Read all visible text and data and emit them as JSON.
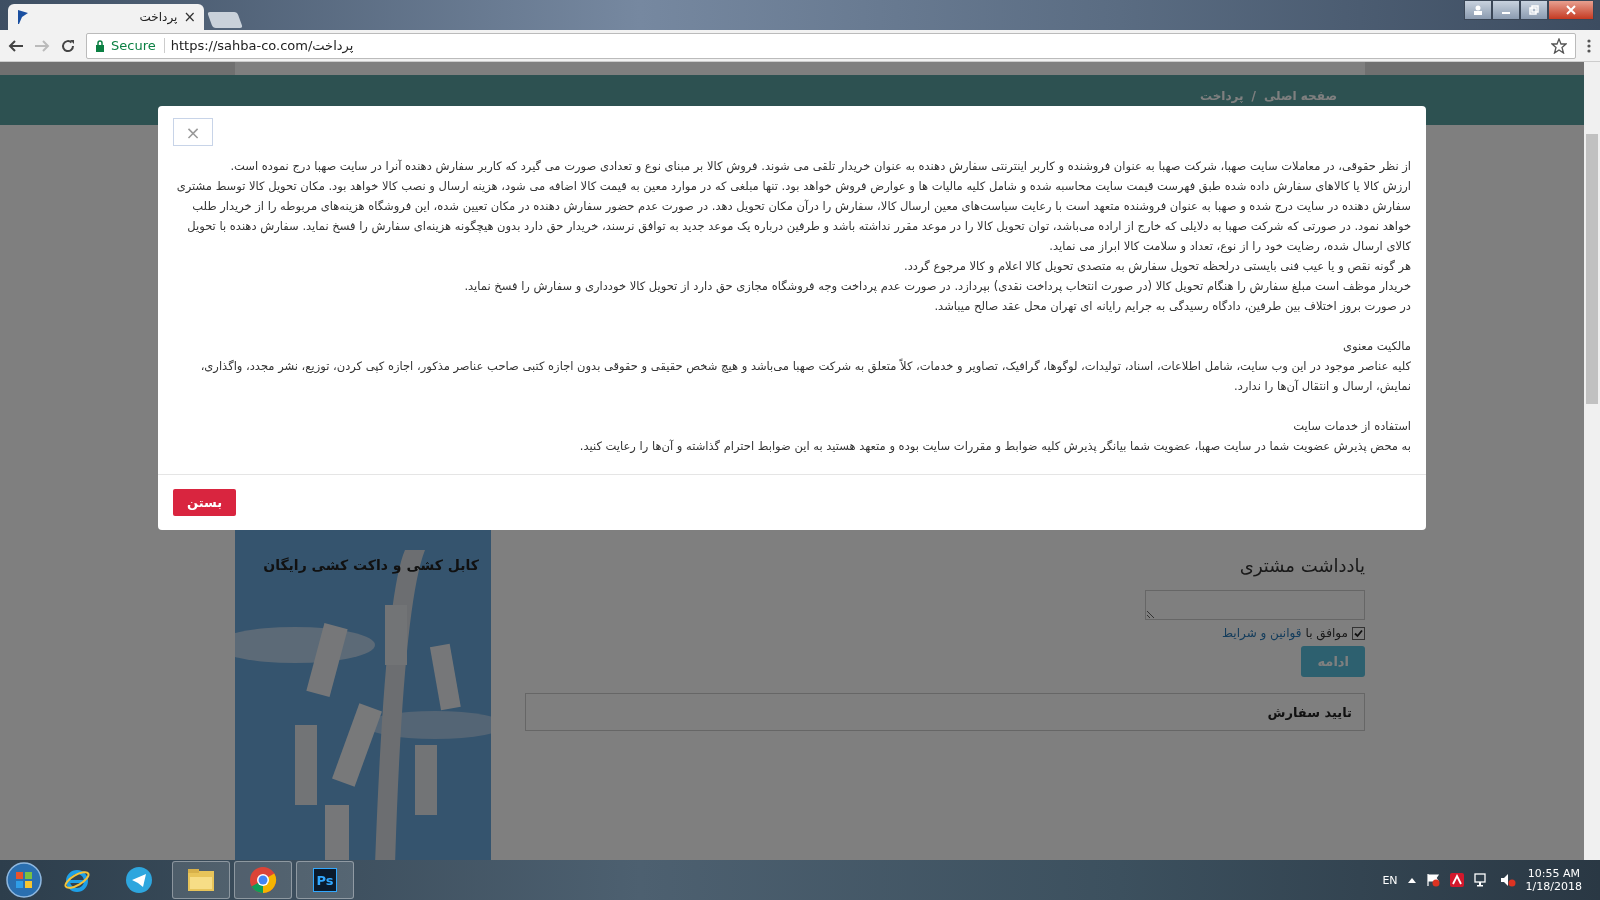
{
  "browser": {
    "tab": {
      "title": "پرداخت",
      "close": "×"
    },
    "address": {
      "secure": "Secure",
      "url": "https://sahba-co.com/پرداخت"
    }
  },
  "page": {
    "breadcrumb": [
      {
        "label": "صفحه اصلی"
      },
      {
        "label": "پرداخت"
      }
    ],
    "breadcrumb_separator": "/",
    "promo": {
      "title": "کابل کشی و داکت کشی رایگان",
      "kind": "picture"
    },
    "customer_note": {
      "heading": "یادداشت مشتری"
    },
    "terms": {
      "checked": true,
      "prefix": "موافق با",
      "link": "قوانین و شرایط"
    },
    "continue_button": "ادامه",
    "order_panel": {
      "title": "تایید سفارش"
    }
  },
  "modal": {
    "close": "×",
    "blocks": [
      {
        "kind": "paragraph",
        "text": "از نظر حقوقی، در معاملات سایت صهبا، شرکت صهبا به عنوان فروشنده و کاربر اینترنتی سفارش دهنده به عنوان خریدار تلقی می شوند. فروش کالا بر مبنای نوع و تعدادی صورت می گیرد که کاربر سفارش دهنده آنرا در سایت صهبا درج نموده است."
      },
      {
        "kind": "paragraph",
        "text": "ارزش کالا یا کالاهای سفارش داده شده طبق فهرست قیمت سایت محاسبه شده و شامل کلیه مالیات ها و عوارض فروش خواهد بود. تنها مبلغی که در موارد معین به قیمت کالا اضافه می شود، هزینه ارسال و نصب کالا خواهد بود. مکان تحویل کالا توسط مشتری سفارش دهنده در سایت درج شده و صهبا به عنوان فروشنده متعهد است با رعایت سیاست‌های معین ارسال کالا، سفارش را درآن مکان تحویل دهد. در صورت عدم حضور سفارش دهنده در مکان تعیین شده، این فروشگاه هزینه‌های مربوطه را از خریدار طلب خواهد نمود. در صورتی که شرکت صهبا به دلایلی که خارج از اراده می‌باشد، توان تحویل کالا را در موعد مقرر نداشته باشد و طرفین درباره یک موعد جدید به توافق نرسند، خریدار حق دارد بدون هیچگونه هزینه‌ای سفارش را فسخ نماید. سفارش دهنده با تحویل کالای ارسال شده، رضایت خود را از نوع، تعداد و سلامت کالا ابراز می نماید."
      },
      {
        "kind": "paragraph",
        "text": "هر گونه نقص و یا عیب فنی بایستی درلحظه تحویل سفارش به متصدی تحویل کالا اعلام و کالا مرجوع گردد."
      },
      {
        "kind": "paragraph",
        "text": "خریدار موظف است مبلغ سفارش را هنگام تحویل کالا (در صورت انتخاب پرداخت نقدی) بپردازد. در صورت عدم پرداخت وجه فروشگاه مجازی حق دارد از تحویل کالا خودداری و سفارش را فسخ نماید."
      },
      {
        "kind": "paragraph",
        "text": "در صورت بروز اختلاف بین طرفین، دادگاه رسیدگی به جرایم رایانه ای تهران محل عقد صالح میباشد."
      },
      {
        "kind": "heading",
        "text": "مالکیت معنوی"
      },
      {
        "kind": "paragraph",
        "text": "کلیه عناصر موجود در این وب سایت، شامل اطلاعات، اسناد، تولیدات، لوگوها، گرافیک، تصاویر و خدمات، کلاً متعلق به شرکت صهبا می‌باشد و هیچ شخص حقیقی و حقوقی بدون اجازه کتبی صاحب عناصر مذکور، اجازه کپی کردن، توزیع، نشر مجدد، واگذاری، نمایش، ارسال و انتقال آن‌ها را ندارد."
      },
      {
        "kind": "heading",
        "text": "استفاده از خدمات سایت"
      },
      {
        "kind": "paragraph",
        "text": "به محض پذیرش عضویت شما در سایت صهبا، عضویت شما بیانگر پذیرش کلیه ضوابط و مقررات سایت بوده و متعهد هستید به این ضوابط احترام گذاشته و آن‌ها را رعایت کنید."
      }
    ],
    "button": "بستن"
  },
  "taskbar": {
    "apps": [
      {
        "kind": "ie",
        "running": false
      },
      {
        "kind": "telegram",
        "running": false
      },
      {
        "kind": "explorer",
        "running": true
      },
      {
        "kind": "chrome",
        "running": true
      },
      {
        "kind": "photoshop",
        "running": true,
        "label": "Ps"
      }
    ],
    "language": "EN",
    "time": "10:55 AM",
    "date": "1/18/2018"
  }
}
